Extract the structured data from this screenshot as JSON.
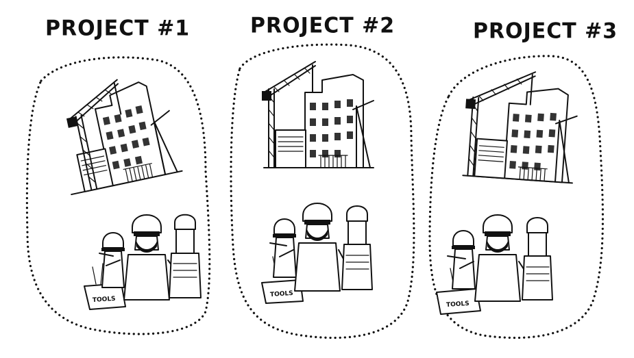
{
  "projects": [
    {
      "title": "PROJECT #1",
      "tools_label": "TOOLS"
    },
    {
      "title": "PROJECT #2",
      "tools_label": "TOOLS"
    },
    {
      "title": "PROJECT #3",
      "tools_label": "TOOLS"
    }
  ]
}
